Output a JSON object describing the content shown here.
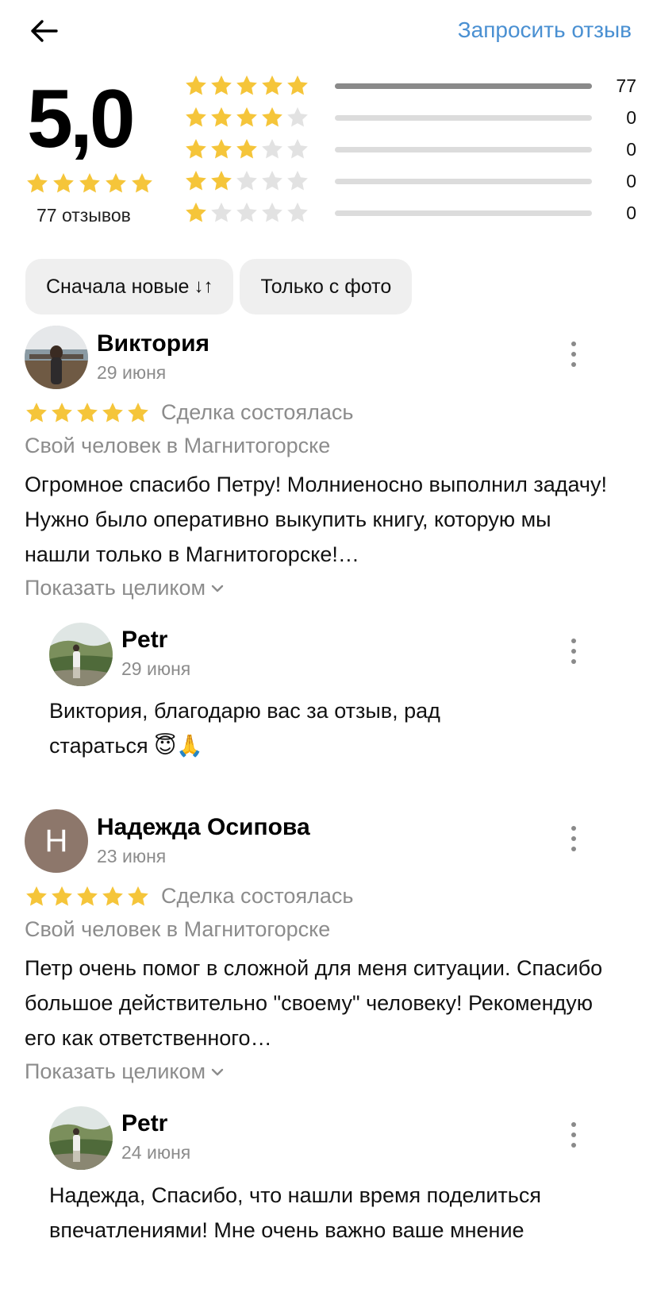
{
  "header": {
    "back_icon": "arrow-left-icon",
    "request_review_label": "Запросить отзыв"
  },
  "summary": {
    "rating": "5,0",
    "rating_value": 5.0,
    "reviews_count_label": "77 отзывов",
    "histogram": [
      {
        "stars": 5,
        "count": "77",
        "fraction": 1.0
      },
      {
        "stars": 4,
        "count": "0",
        "fraction": 0
      },
      {
        "stars": 3,
        "count": "0",
        "fraction": 0
      },
      {
        "stars": 2,
        "count": "0",
        "fraction": 0
      },
      {
        "stars": 1,
        "count": "0",
        "fraction": 0
      }
    ]
  },
  "filters": {
    "sort_label": "Сначала новые",
    "sort_icon": "sort-arrows-icon",
    "photo_label": "Только с фото"
  },
  "reviews": [
    {
      "author": "Виктория",
      "date": "29 июня",
      "stars": 5,
      "deal_status": "Сделка состоялась",
      "service": "Свой человек в Магнитогорске",
      "text": "Огромное спасибо Петру! Молниеносно выполнил задачу! Нужно было оперативно выкупить книгу, которую мы нашли только в Магнитогорске!…",
      "show_full_label": "Показать целиком",
      "reply": {
        "author": "Petr",
        "date": "29 июня",
        "text": "Виктория, благодарю вас за отзыв, рад стараться 😇🙏"
      }
    },
    {
      "author": "Надежда Осипова",
      "avatar_letter": "Н",
      "date": "23 июня",
      "stars": 5,
      "deal_status": "Сделка состоялась",
      "service": "Свой человек в Магнитогорске",
      "text": "Петр очень помог в сложной для меня ситуации. Спасибо большое действительно \"своему\" человеку! Рекомендую его как ответственного…",
      "show_full_label": "Показать целиком",
      "reply": {
        "author": "Petr",
        "date": "24 июня",
        "text": "Надежда, Спасибо, что нашли время поделиться впечатлениями! Мне очень важно ваше мнение"
      }
    }
  ],
  "colors": {
    "accent": "#4a90d2",
    "star_filled": "#f5c53a",
    "star_empty": "#e2e2e2",
    "muted_text": "#8c8c8c"
  }
}
